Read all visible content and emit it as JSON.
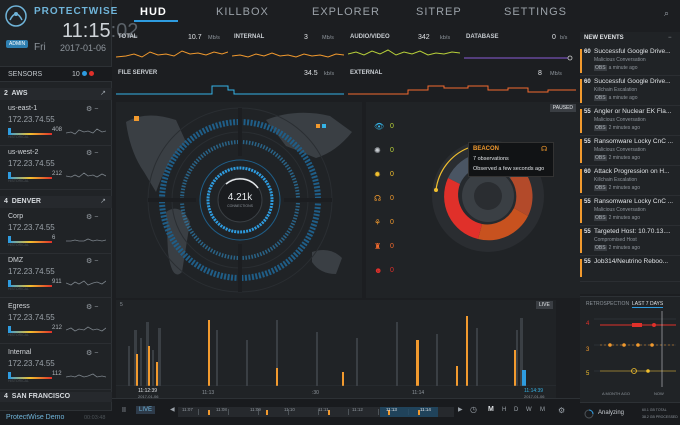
{
  "app": {
    "brand": "PROTECTWISE",
    "clock_main": "11:15",
    "clock_sec": ":02",
    "role_badge": "ADMIN",
    "day": "Fri",
    "date": "2017-01-06"
  },
  "nav": [
    {
      "label": "HUD"
    },
    {
      "label": "KILLBOX"
    },
    {
      "label": "EXPLORER"
    },
    {
      "label": "SITREP"
    },
    {
      "label": "SETTINGS"
    }
  ],
  "metrics": [
    {
      "title": "TOTAL",
      "value": "10.7",
      "unit": "Mb/s",
      "color": "#f29a2e"
    },
    {
      "title": "INTERNAL",
      "value": "3",
      "unit": "Mb/s",
      "color": "#f29a2e"
    },
    {
      "title": "AUDIO/VIDEO",
      "value": "342",
      "unit": "kb/s",
      "color": "#b9d23a"
    },
    {
      "title": "DATABASE",
      "value": "0",
      "unit": "b/s",
      "color": "#8a5cd6"
    },
    {
      "title": "FILE SERVER",
      "value": "34.5",
      "unit": "kb/s",
      "color": "#35b3e6"
    },
    {
      "title": "EXTERNAL",
      "value": "8",
      "unit": "Mb/s",
      "color": "#f26a2e"
    }
  ],
  "sidebar": {
    "header": "SENSORS",
    "total": "10",
    "groups": [
      {
        "count": "2",
        "name": "AWS",
        "sensors": [
          {
            "name": "us-east-1",
            "ip": "172.23.74.55",
            "count": "408",
            "label": "HISTORICAL"
          },
          {
            "name": "us-west-2",
            "ip": "172.23.74.55",
            "count": "212",
            "label": "HISTORICAL"
          }
        ]
      },
      {
        "count": "4",
        "name": "DENVER",
        "sensors": [
          {
            "name": "Corp",
            "ip": "172.23.74.55",
            "count": "6",
            "label": "HISTORICAL"
          },
          {
            "name": "DMZ",
            "ip": "172.23.74.55",
            "count": "911",
            "label": "HISTORICAL"
          },
          {
            "name": "Egress",
            "ip": "172.23.74.55",
            "count": "212",
            "label": "HISTORICAL"
          },
          {
            "name": "Internal",
            "ip": "172.23.74.55",
            "count": "112",
            "label": "HISTORICAL"
          }
        ]
      },
      {
        "count": "4",
        "name": "SAN FRANCISCO",
        "sensors": []
      }
    ],
    "footer": "ProtectWise Demo",
    "footer_time": "00:03:48"
  },
  "center": {
    "paused": "PAUSED",
    "connections_value": "4.21k",
    "connections_label": "CONNECTIONS",
    "threat_counts": [
      "0",
      "0",
      "0",
      "0",
      "0",
      "0",
      "0"
    ],
    "tooltip": {
      "title": "BEACON",
      "line1": "7 observations",
      "line2": "Observed a few seconds ago"
    }
  },
  "events": {
    "header": "NEW EVENTS",
    "items": [
      {
        "score": "60",
        "title": "Successful Google Drive...",
        "sub": "Malicious Conversation",
        "obs": "OBS",
        "ago": "a minute ago"
      },
      {
        "score": "60",
        "title": "Successful Google Drive...",
        "sub": "Killchain Escalation",
        "obs": "OBS",
        "ago": "a minute ago"
      },
      {
        "score": "55",
        "title": "Angler or Nuclear EK Fla...",
        "sub": "Malicious Conversation",
        "obs": "OBS",
        "ago": "2 minutes ago"
      },
      {
        "score": "55",
        "title": "Ransomware Locky CnC ...",
        "sub": "Malicious Conversation",
        "obs": "OBS",
        "ago": "2 minutes ago"
      },
      {
        "score": "60",
        "title": "Attack Progression on H...",
        "sub": "Killchain Escalation",
        "obs": "OBS",
        "ago": "2 minutes ago"
      },
      {
        "score": "55",
        "title": "Ransomware Locky CnC ...",
        "sub": "Malicious Conversation",
        "obs": "OBS",
        "ago": "2 minutes ago"
      },
      {
        "score": "55",
        "title": "Targeted Host: 10.70.13....",
        "sub": "Compromised Host",
        "obs": "OBS",
        "ago": "2 minutes ago"
      },
      {
        "score": "55",
        "title": "Job314/Neutrino Reboo...",
        "sub": "",
        "obs": "",
        "ago": ""
      }
    ]
  },
  "retro": {
    "tab1": "RETROSPECTION",
    "tab2": "LAST 7 DAYS",
    "rows": [
      "4",
      "3",
      "5"
    ],
    "label_left": "A MONTH AGO",
    "label_right": "NOW",
    "status": "Analyzing",
    "stat1": "60.1 GB TOTAL",
    "stat2": "38.2 GB PROCESSED"
  },
  "timeline": {
    "live_label": "LIVE",
    "start_time": "11:12:39",
    "start_date": "2017-01-06",
    "end_time": "11:14:39",
    "end_date": "2017-01-06",
    "ticks": [
      "11:13",
      ":30",
      "11:14"
    ],
    "ymax": "5",
    "controls": {
      "pause": "II",
      "live": "LIVE",
      "ranges": [
        "M",
        "H",
        "D",
        "W",
        "M"
      ]
    },
    "scrub_ticks": [
      "11:07",
      "11:08",
      "11:09",
      "11:10",
      "11:11",
      "11:12",
      "11:13",
      "11:14"
    ]
  },
  "colors": {
    "accent": "#2e9ce0",
    "orange": "#f29a2e",
    "red": "#e0302a"
  }
}
